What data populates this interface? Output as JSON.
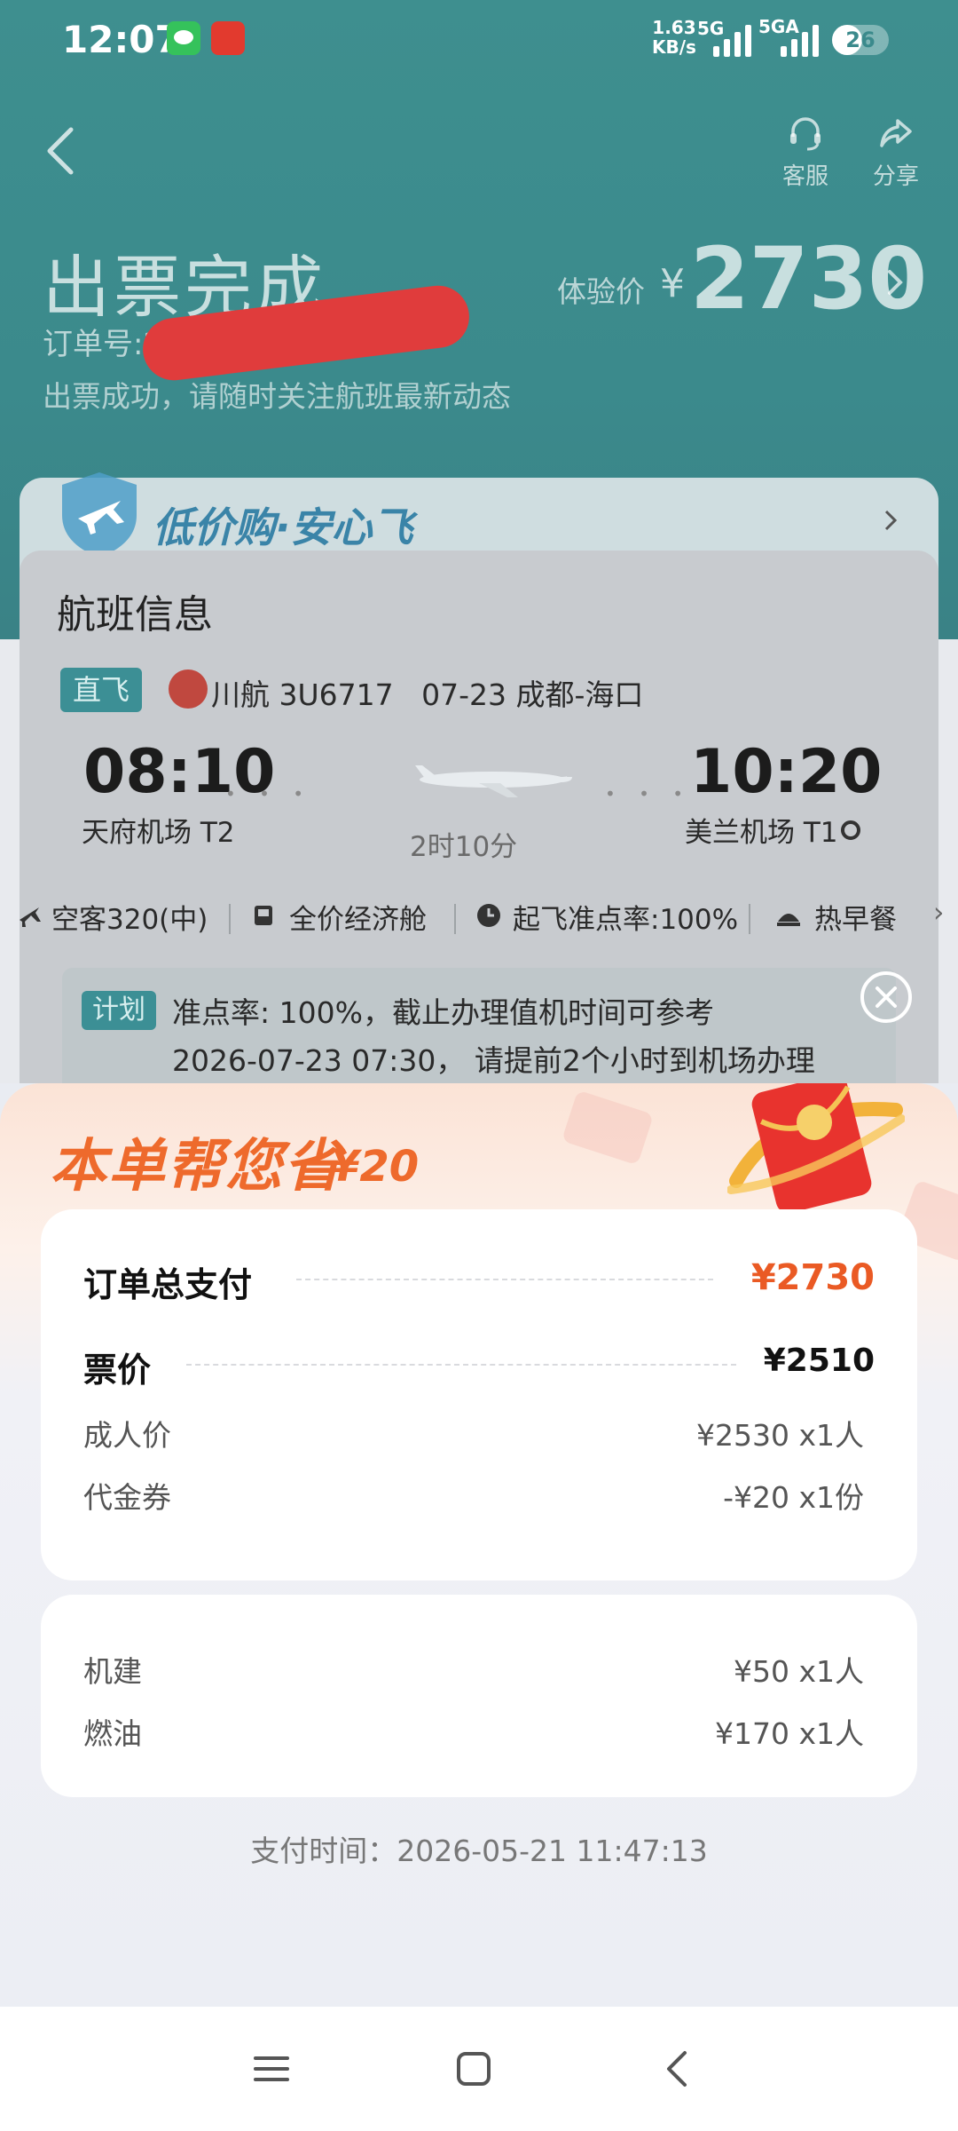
{
  "status_bar": {
    "time": "12:07",
    "speed_value": "1.63",
    "speed_unit": "KB/s",
    "net1": "5G",
    "net2": "5GA",
    "battery": "26",
    "apps": [
      "wechat-icon",
      "ctrip-icon"
    ]
  },
  "nav": {
    "service_label": "客服",
    "share_label": "分享"
  },
  "order": {
    "status_title": "出票完成",
    "order_no_label": "订单号:20",
    "tip": "出票成功，请随时关注航班最新动态",
    "price_label": "体验价",
    "price_currency": "¥",
    "price_value": "2730"
  },
  "banner": {
    "text": "低价购·安心飞"
  },
  "flight": {
    "section_title": "航班信息",
    "tag": "直飞",
    "airline": "川航 3U6717",
    "date_route": "07-23 成都-海口",
    "dep_time": "08:10",
    "dep_airport": "天府机场 T2",
    "arr_time": "10:20",
    "arr_airport": "美兰机场 T1",
    "duration": "2时10分",
    "features": [
      "空客320(中)",
      "全价经济舱",
      "起飞准点率:100%",
      "热早餐"
    ],
    "plan_tag": "计划",
    "plan_line1": "准点率: 100%，截止办理值机时间可参考",
    "plan_line2": "2026-07-23 07:30， 请提前2个小时到机场办理"
  },
  "sheet": {
    "title": "本单帮您省",
    "save_amount": "¥20",
    "total_label": "订单总支付",
    "total_value": "¥2730",
    "ticket_label": "票价",
    "ticket_value": "¥2510",
    "adult_label": "成人价",
    "adult_value": "¥2530 x1人",
    "voucher_label": "代金券",
    "voucher_value": "-¥20 x1份",
    "airport_fee_label": "机建",
    "airport_fee_value": "¥50 x1人",
    "fuel_label": "燃油",
    "fuel_value": "¥170 x1人",
    "pay_time": "支付时间：2026-05-21 11:47:13"
  },
  "colors": {
    "header_teal": "#3b8a8c",
    "accent_orange": "#ea5a24",
    "redaction": "#e03c3c"
  }
}
